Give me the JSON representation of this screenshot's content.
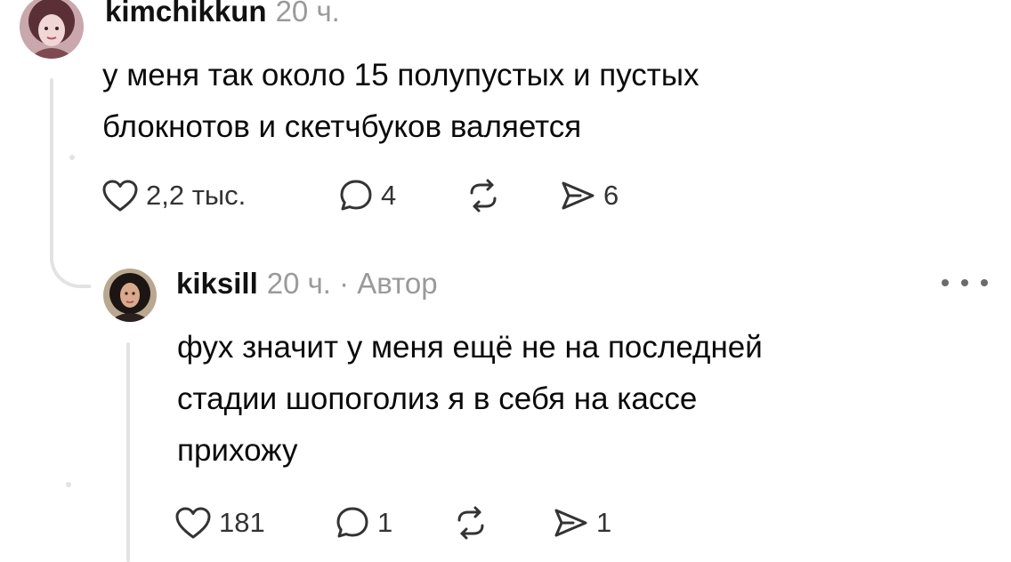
{
  "thread": {
    "comments": [
      {
        "author": "kimchikkun",
        "time": "20 ч.",
        "text_lines": [
          "у меня так около 15 полупустых и пустых",
          "блокнотов и скетчбуков валяется"
        ],
        "actions": {
          "like_count": "2,2 тыс.",
          "reply_count": "4",
          "repost_count": "",
          "share_count": "6"
        },
        "avatar_icon": "avatar-girl-pink-hair-icon"
      },
      {
        "author": "kiksill",
        "meta": "20 ч. · Автор",
        "text_lines": [
          "фух значит у меня ещё не на последней",
          "стадии шопоголиз я в себя на кассе",
          "прихожу"
        ],
        "actions": {
          "like_count": "181",
          "reply_count": "1",
          "repost_count": "",
          "share_count": "1"
        },
        "avatar_icon": "avatar-woman-dark-hair-icon"
      }
    ]
  },
  "icons": {
    "like": "heart-outline-icon",
    "reply": "speech-bubble-icon",
    "repost": "repost-arrows-icon",
    "share": "send-paper-plane-icon",
    "more": "more-dots-icon"
  },
  "colors": {
    "text": "#0a0a0a",
    "muted": "#9a9a9a",
    "icon": "#333333",
    "thread_line": "#e3e3e3"
  }
}
